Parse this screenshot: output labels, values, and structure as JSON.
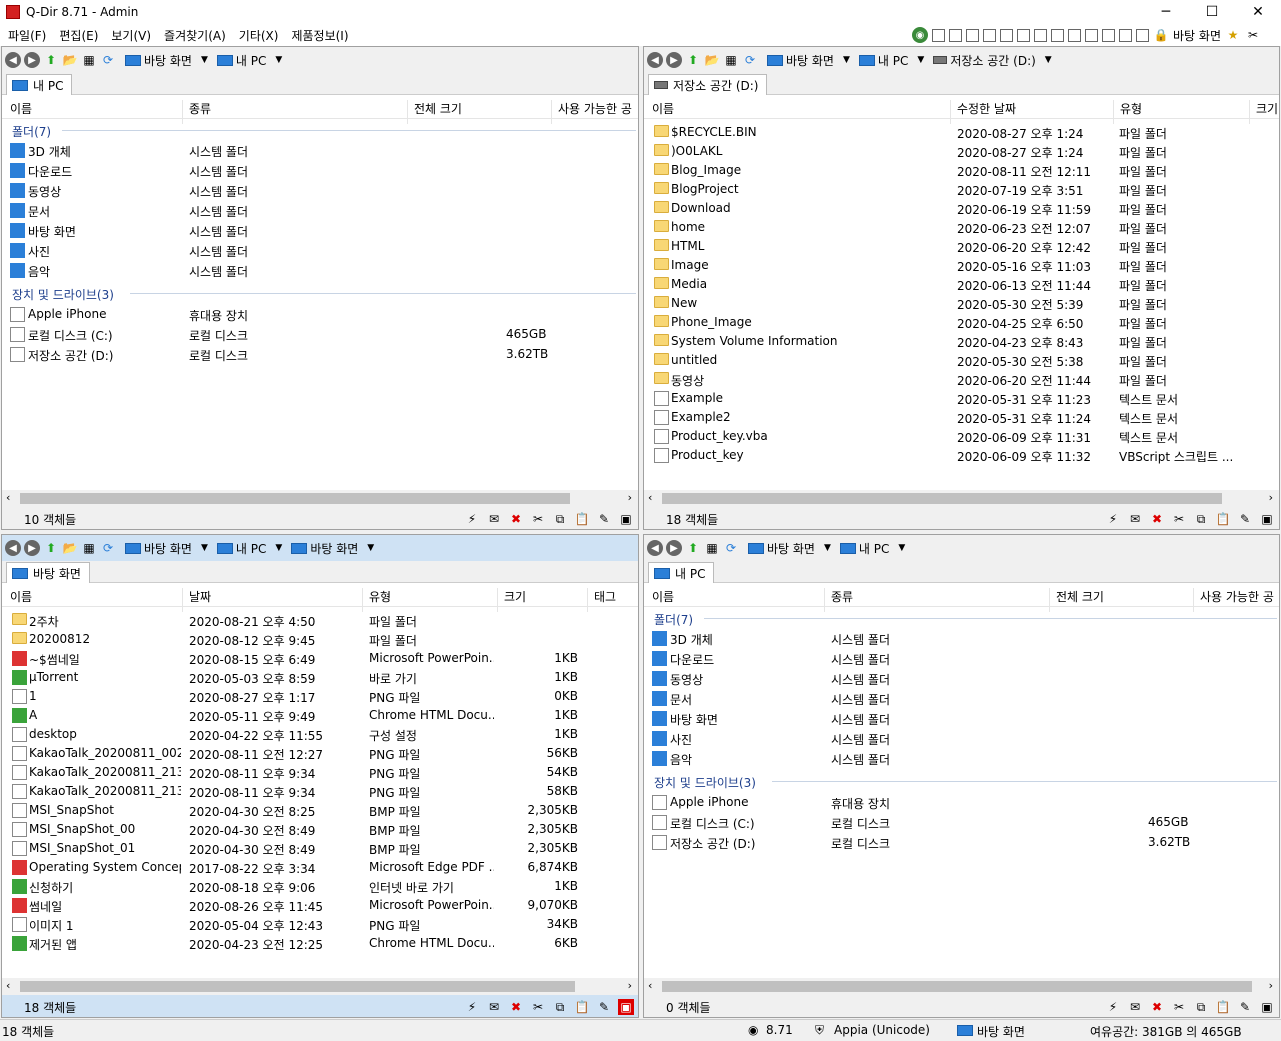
{
  "window": {
    "title": "Q-Dir 8.71 - Admin",
    "min": "─",
    "max": "☐",
    "close": "✕"
  },
  "menu": [
    "파일(F)",
    "편집(E)",
    "보기(V)",
    "즐겨찾기(A)",
    "기타(X)",
    "제품정보(I)"
  ],
  "menu_right_label": "바탕 화면",
  "panes": {
    "tl": {
      "loc1": "바탕 화면",
      "loc2": "내 PC",
      "loc3": "",
      "tab": "내 PC",
      "headers": [
        "이름",
        "종류",
        "전체 크기",
        "사용 가능한 공"
      ],
      "group1": "폴더(7)",
      "group2": "장치 및 드라이브(3)",
      "folders": [
        [
          "3D 개체",
          "시스템 폴더"
        ],
        [
          "다운로드",
          "시스템 폴더"
        ],
        [
          "동영상",
          "시스템 폴더"
        ],
        [
          "문서",
          "시스템 폴더"
        ],
        [
          "바탕 화면",
          "시스템 폴더"
        ],
        [
          "사진",
          "시스템 폴더"
        ],
        [
          "음악",
          "시스템 폴더"
        ]
      ],
      "drives": [
        [
          "Apple iPhone",
          "휴대용 장치",
          ""
        ],
        [
          "로컬 디스크 (C:)",
          "로컬 디스크",
          "465GB"
        ],
        [
          "저장소 공간 (D:)",
          "로컬 디스크",
          "3.62TB"
        ]
      ],
      "status": "10 객체들"
    },
    "tr": {
      "loc1": "바탕 화면",
      "loc2": "내 PC",
      "loc3": "저장소 공간 (D:)",
      "tab": "저장소 공간 (D:)",
      "headers": [
        "이름",
        "수정한 날짜",
        "유형",
        "크기"
      ],
      "rows": [
        [
          "$RECYCLE.BIN",
          "2020-08-27 오후 1:24",
          "파일 폴더",
          "f"
        ],
        [
          ")O0LAKL",
          "2020-08-27 오후 1:24",
          "파일 폴더",
          "f"
        ],
        [
          "Blog_Image",
          "2020-08-11 오전 12:11",
          "파일 폴더",
          "f"
        ],
        [
          "BlogProject",
          "2020-07-19 오후 3:51",
          "파일 폴더",
          "f"
        ],
        [
          "Download",
          "2020-06-19 오후 11:59",
          "파일 폴더",
          "f"
        ],
        [
          "home",
          "2020-06-23 오전 12:07",
          "파일 폴더",
          "f"
        ],
        [
          "HTML",
          "2020-06-20 오후 12:42",
          "파일 폴더",
          "f"
        ],
        [
          "Image",
          "2020-05-16 오후 11:03",
          "파일 폴더",
          "f"
        ],
        [
          "Media",
          "2020-06-13 오전 11:44",
          "파일 폴더",
          "f"
        ],
        [
          "New",
          "2020-05-30 오전 5:39",
          "파일 폴더",
          "f"
        ],
        [
          "Phone_Image",
          "2020-04-25 오후 6:50",
          "파일 폴더",
          "f"
        ],
        [
          "System Volume Information",
          "2020-04-23 오후 8:43",
          "파일 폴더",
          "f"
        ],
        [
          "untitled",
          "2020-05-30 오전 5:38",
          "파일 폴더",
          "f"
        ],
        [
          "동영상",
          "2020-06-20 오전 11:44",
          "파일 폴더",
          "f"
        ],
        [
          "Example",
          "2020-05-31 오후 11:23",
          "텍스트 문서",
          "d"
        ],
        [
          "Example2",
          "2020-05-31 오후 11:24",
          "텍스트 문서",
          "d"
        ],
        [
          "Product_key.vba",
          "2020-06-09 오후 11:31",
          "텍스트 문서",
          "d"
        ],
        [
          "Product_key",
          "2020-06-09 오후 11:32",
          "VBScript 스크립트 ...",
          "v"
        ]
      ],
      "status": "18 객체들"
    },
    "bl": {
      "loc1": "바탕 화면",
      "loc2": "내 PC",
      "loc3": "바탕 화면",
      "tab": "바탕 화면",
      "headers": [
        "이름",
        "날짜",
        "유형",
        "크기",
        "태그"
      ],
      "rows": [
        [
          "2주차",
          "2020-08-21 오후 4:50",
          "파일 폴더",
          "",
          "f"
        ],
        [
          "20200812",
          "2020-08-12 오후 9:45",
          "파일 폴더",
          "",
          "f"
        ],
        [
          "~$썸네일",
          "2020-08-15 오후 6:49",
          "Microsoft PowerPoin...",
          "1KB",
          "p"
        ],
        [
          "µTorrent",
          "2020-05-03 오후 8:59",
          "바로 가기",
          "1KB",
          "g"
        ],
        [
          "1",
          "2020-08-27 오후 1:17",
          "PNG 파일",
          "0KB",
          "d"
        ],
        [
          "A",
          "2020-05-11 오후 9:49",
          "Chrome HTML Docu...",
          "1KB",
          "c"
        ],
        [
          "desktop",
          "2020-04-22 오후 11:55",
          "구성 설정",
          "1KB",
          "d"
        ],
        [
          "KakaoTalk_20200811_002...",
          "2020-08-11 오전 12:27",
          "PNG 파일",
          "56KB",
          "d"
        ],
        [
          "KakaoTalk_20200811_213...",
          "2020-08-11 오후 9:34",
          "PNG 파일",
          "54KB",
          "d"
        ],
        [
          "KakaoTalk_20200811_213...",
          "2020-08-11 오후 9:34",
          "PNG 파일",
          "58KB",
          "d"
        ],
        [
          "MSI_SnapShot",
          "2020-04-30 오전 8:25",
          "BMP 파일",
          "2,305KB",
          "d"
        ],
        [
          "MSI_SnapShot_00",
          "2020-04-30 오전 8:49",
          "BMP 파일",
          "2,305KB",
          "d"
        ],
        [
          "MSI_SnapShot_01",
          "2020-04-30 오전 8:49",
          "BMP 파일",
          "2,305KB",
          "d"
        ],
        [
          "Operating System Concep...",
          "2017-08-22 오후 3:34",
          "Microsoft Edge PDF ...",
          "6,874KB",
          "r"
        ],
        [
          "신청하기",
          "2020-08-18 오후 9:06",
          "인터넷 바로 가기",
          "1KB",
          "c"
        ],
        [
          "썸네일",
          "2020-08-26 오후 11:45",
          "Microsoft PowerPoin...",
          "9,070KB",
          "p"
        ],
        [
          "이미지 1",
          "2020-05-04 오후 12:43",
          "PNG 파일",
          "34KB",
          "d"
        ],
        [
          "제거된 앱",
          "2020-04-23 오전 12:25",
          "Chrome HTML Docu...",
          "6KB",
          "c"
        ]
      ],
      "status": "18 객체들"
    },
    "br": {
      "loc1": "바탕 화면",
      "loc2": "내 PC",
      "loc3": "",
      "tab": "내 PC",
      "headers": [
        "이름",
        "종류",
        "전체 크기",
        "사용 가능한 공"
      ],
      "group1": "폴더(7)",
      "group2": "장치 및 드라이브(3)",
      "folders": [
        [
          "3D 개체",
          "시스템 폴더"
        ],
        [
          "다운로드",
          "시스템 폴더"
        ],
        [
          "동영상",
          "시스템 폴더"
        ],
        [
          "문서",
          "시스템 폴더"
        ],
        [
          "바탕 화면",
          "시스템 폴더"
        ],
        [
          "사진",
          "시스템 폴더"
        ],
        [
          "음악",
          "시스템 폴더"
        ]
      ],
      "drives": [
        [
          "Apple iPhone",
          "휴대용 장치",
          ""
        ],
        [
          "로컬 디스크 (C:)",
          "로컬 디스크",
          "465GB"
        ],
        [
          "저장소 공간 (D:)",
          "로컬 디스크",
          "3.62TB"
        ]
      ],
      "status": "0 객체들"
    }
  },
  "bottom": {
    "count": "18 객체들",
    "version": "8.71",
    "appia": "Appia (Unicode)",
    "loc": "바탕 화면",
    "free": "여유공간: 381GB 의 465GB"
  }
}
